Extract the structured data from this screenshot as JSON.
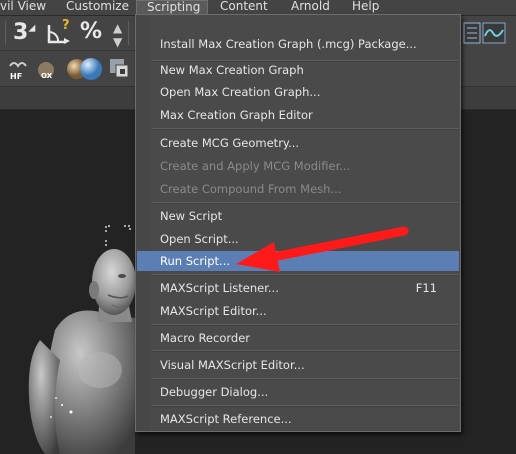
{
  "menubar": {
    "items": [
      {
        "label": "vil View"
      },
      {
        "label": "Customize"
      },
      {
        "label": "Scripting"
      },
      {
        "label": "Content"
      },
      {
        "label": "Arnold"
      },
      {
        "label": "Help"
      }
    ]
  },
  "toolbar": {
    "snap_label": "3",
    "percent_label": "%",
    "angle_label": "?"
  },
  "scripting_menu": {
    "items": [
      {
        "label": "Install Max Creation Graph (.mcg) Package...",
        "enabled": true
      },
      {
        "label": "New Max Creation Graph",
        "enabled": true
      },
      {
        "label": "Open Max Creation Graph...",
        "enabled": true
      },
      {
        "label": "Max Creation Graph Editor",
        "enabled": true
      },
      {
        "label": "Create MCG Geometry...",
        "enabled": true
      },
      {
        "label": "Create and Apply MCG Modifier...",
        "enabled": false
      },
      {
        "label": "Create Compound From Mesh...",
        "enabled": false
      },
      {
        "label": "New Script",
        "enabled": true
      },
      {
        "label": "Open Script...",
        "enabled": true
      },
      {
        "label": "Run Script...",
        "enabled": true,
        "highlighted": true
      },
      {
        "label": "MAXScript Listener...",
        "enabled": true,
        "shortcut": "F11"
      },
      {
        "label": "MAXScript Editor...",
        "enabled": true
      },
      {
        "label": "Macro Recorder",
        "enabled": true
      },
      {
        "label": "Visual MAXScript Editor...",
        "enabled": true
      },
      {
        "label": "Debugger Dialog...",
        "enabled": true
      },
      {
        "label": "MAXScript Reference...",
        "enabled": true
      }
    ]
  },
  "colors": {
    "highlight": "#5b7fb5",
    "annotation_arrow": "#ff1a1a",
    "menu_bg": "#4a4a4a"
  }
}
